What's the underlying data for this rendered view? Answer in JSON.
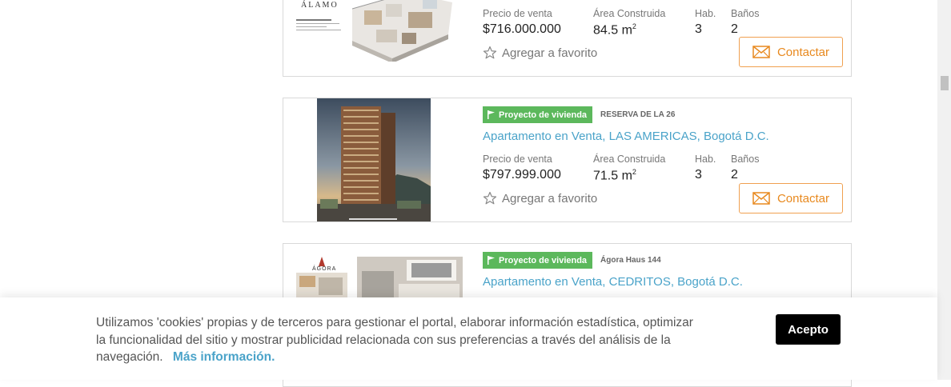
{
  "labels": {
    "price": "Precio de venta",
    "area": "Área Construida",
    "rooms": "Hab.",
    "baths": "Baños",
    "favorite": "Agregar a favorito",
    "contact": "Contactar",
    "badge": "Proyecto de vivienda",
    "area_unit": "m",
    "area_unit_exp": "2"
  },
  "listings": [
    {
      "logo_text": "ÁLAMO",
      "price": "$716.000.000",
      "area": "84.5",
      "rooms": "3",
      "baths": "2"
    },
    {
      "project": "RESERVA DE LA 26",
      "title": "Apartamento en Venta, LAS AMERICAS, Bogotá D.C.",
      "price": "$797.999.000",
      "area": "71.5",
      "rooms": "3",
      "baths": "2"
    },
    {
      "project": "Ágora Haus 144",
      "title": "Apartamento en Venta, CEDRITOS, Bogotá D.C.",
      "logo_text": "ÁGORA"
    }
  ],
  "cookie": {
    "text": "Utilizamos 'cookies' propias y de terceros para gestionar el portal, elaborar información estadística, optimizar la funcionalidad del sitio y mostrar publicidad relacionada con sus preferencias a través del análisis de la navegación.",
    "link": "Más información.",
    "accept": "Acepto"
  },
  "colors": {
    "accent_blue": "#4aa3c9",
    "badge_green": "#5cb85c",
    "contact_orange": "#e8891e"
  },
  "icons": {
    "badge": "flag-icon",
    "favorite": "star-outline-icon",
    "contact": "envelope-icon"
  }
}
